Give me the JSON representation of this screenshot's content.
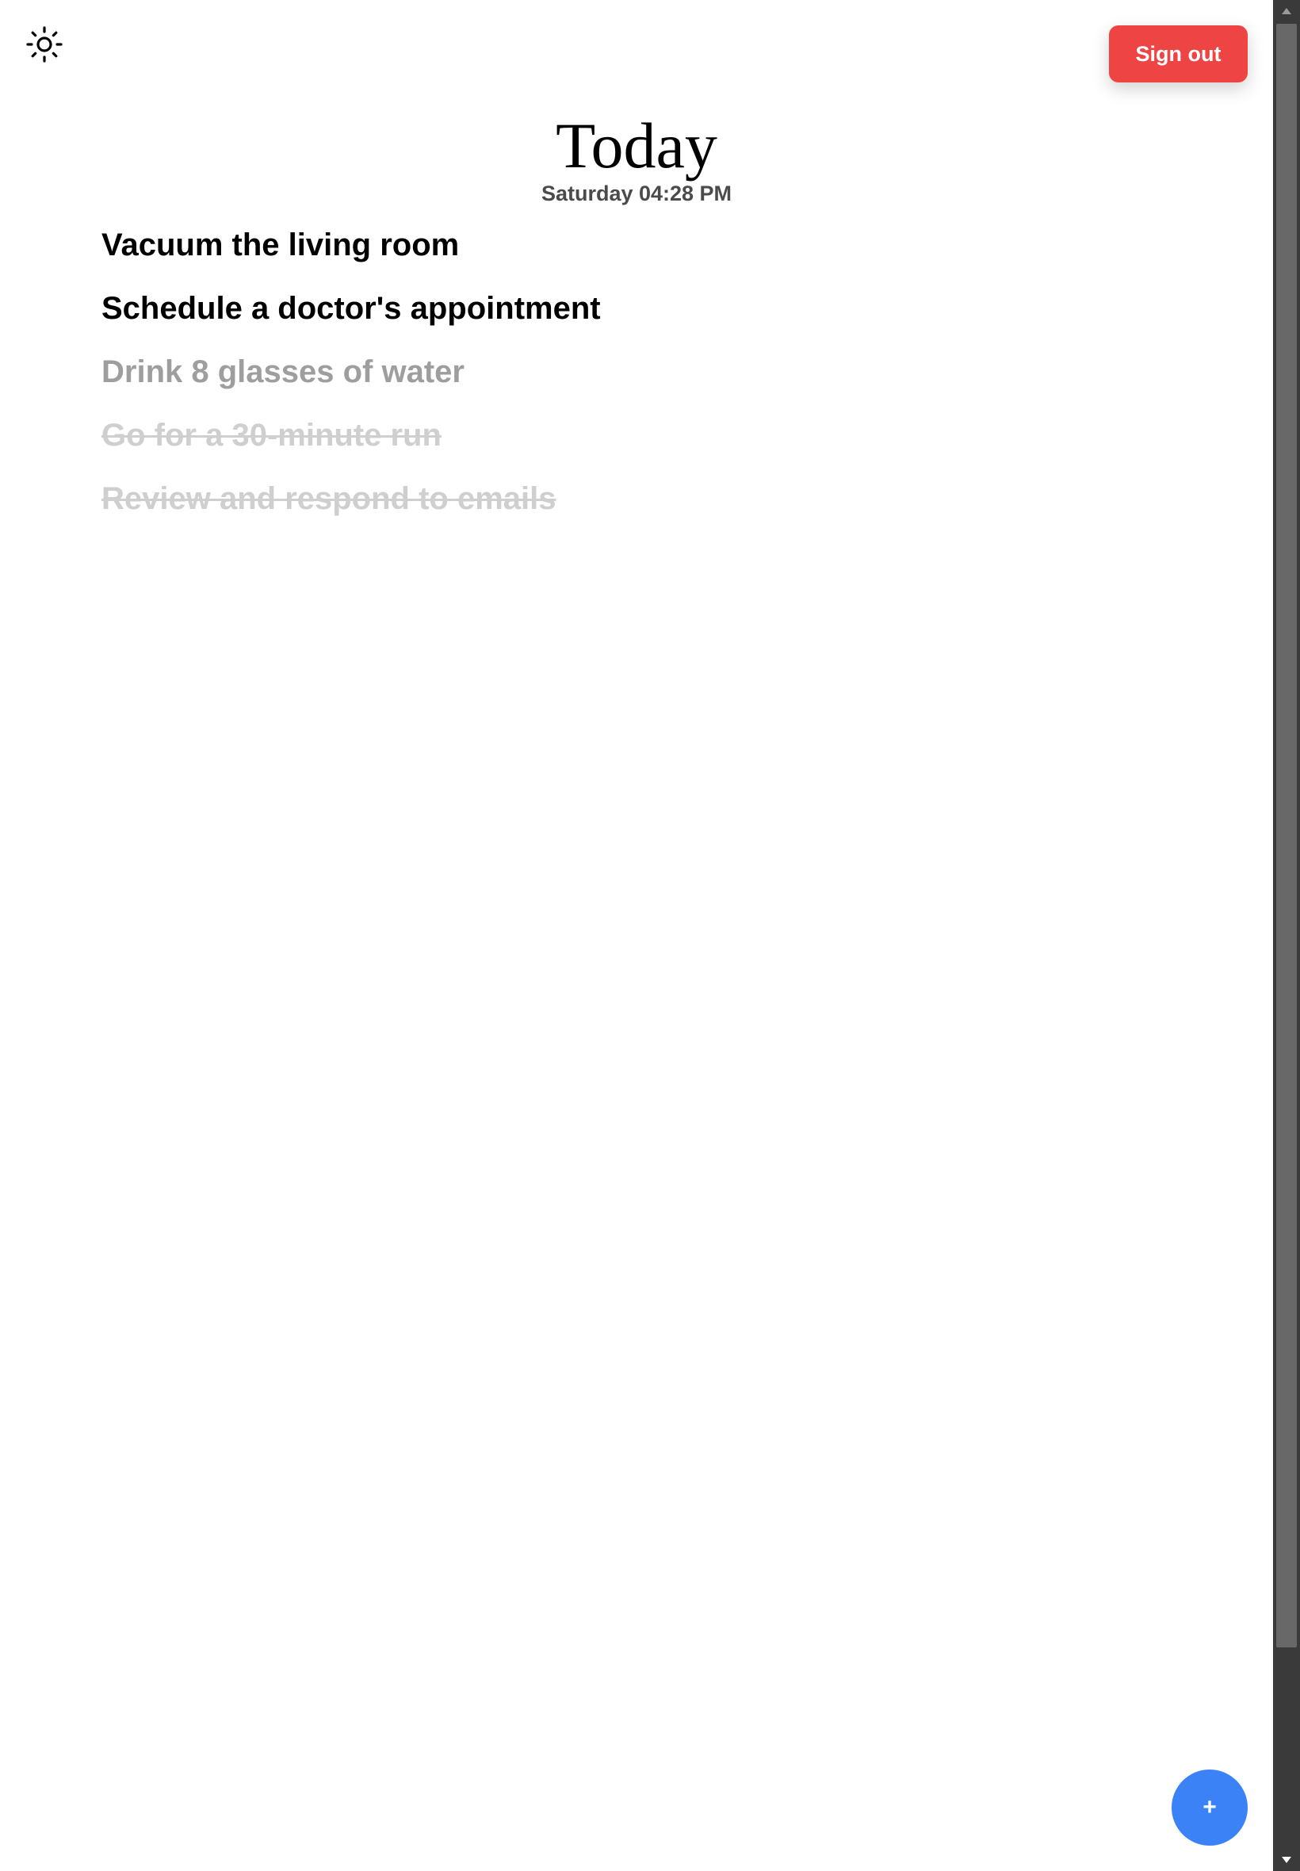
{
  "header": {
    "theme_toggle_icon": "sun-icon",
    "sign_out_label": "Sign out",
    "sign_out_color": "#ef4444"
  },
  "main": {
    "title": "Today",
    "datetime": "Saturday 04:28 PM"
  },
  "tasks": [
    {
      "label": "Vacuum the living room",
      "state": "active"
    },
    {
      "label": "Schedule a doctor's appointment",
      "state": "active"
    },
    {
      "label": "Drink 8 glasses of water",
      "state": "muted"
    },
    {
      "label": "Go for a 30-minute run",
      "state": "done"
    },
    {
      "label": "Review and respond to emails",
      "state": "done"
    }
  ],
  "fab": {
    "label": "+",
    "color": "#3b82f6"
  },
  "scrollbar": {
    "up_icon": "scroll-up-arrow-icon",
    "down_icon": "scroll-down-arrow-icon"
  }
}
